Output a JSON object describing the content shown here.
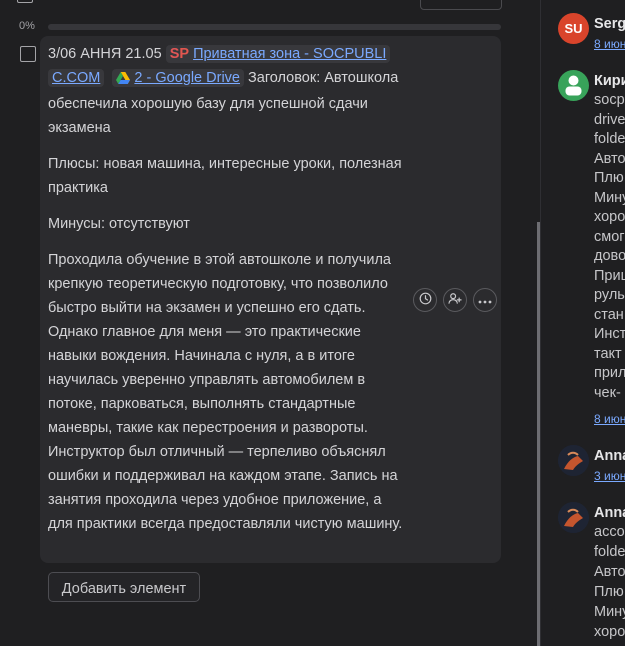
{
  "checklist": {
    "progress_label": "0%",
    "progress": 0,
    "item": {
      "prefix": "3/06 АННЯ 21.05",
      "sp_logo": "SP",
      "link1": "Приватная зона - SOCPUBLI",
      "link1_cont": "C.COM",
      "link2": "2 - Google Drive",
      "heading_label": "Заголовок:",
      "heading_text": "Автошкола обеспечила хорошую базу для успешной сдачи экзамена",
      "pros": "Плюсы: новая машина, интересные уроки, полезная практика",
      "cons": "Минусы: отсутствуют",
      "body": "Проходила обучение в этой автошколе и получила крепкую теоретическую подготовку, что позволило быстро выйти на экзамен и успешно его сдать. Однако главное для меня — это практические навыки вождения. Начинала с нуля, а в итоге научилась уверенно управлять автомобилем в потоке, парковаться, выполнять стандартные маневры, такие как перестроения и развороты. Инструктор был отличный — терпеливо объяснял ошибки и поддерживал на каждом этапе. Запись на занятия проходила через удобное приложение, а для практики всегда предоставляли чистую машину."
    },
    "add_button": "Добавить элемент"
  },
  "activity": [
    {
      "avatar_text": "SU",
      "name": "Serg",
      "lines": [],
      "date": "8 июн"
    },
    {
      "avatar_text": "",
      "name": "Кири",
      "lines": [
        "socp",
        "drive",
        "folde",
        "Авто",
        "Плю",
        "Мину",
        "хоро",
        "смог",
        "дово",
        "Приш",
        "руль",
        "стан",
        "Инст",
        "такт",
        "прил",
        "чек-"
      ],
      "date": "8 июн"
    },
    {
      "avatar_text": "",
      "name": "Anna",
      "lines": [],
      "date": "3 июн"
    },
    {
      "avatar_text": "",
      "name": "Anna",
      "lines": [
        "acco",
        "folde",
        "Авто",
        "Плю",
        "Мину",
        "хоро"
      ],
      "date": ""
    }
  ],
  "icons": [
    "clock-icon",
    "assign-user-icon",
    "more-icon",
    "google-drive-icon"
  ],
  "colors": {
    "accent": "#5aa0ff",
    "link": "#7aa9ff",
    "card": "#2b2b2e",
    "background": "#1f1f21"
  }
}
